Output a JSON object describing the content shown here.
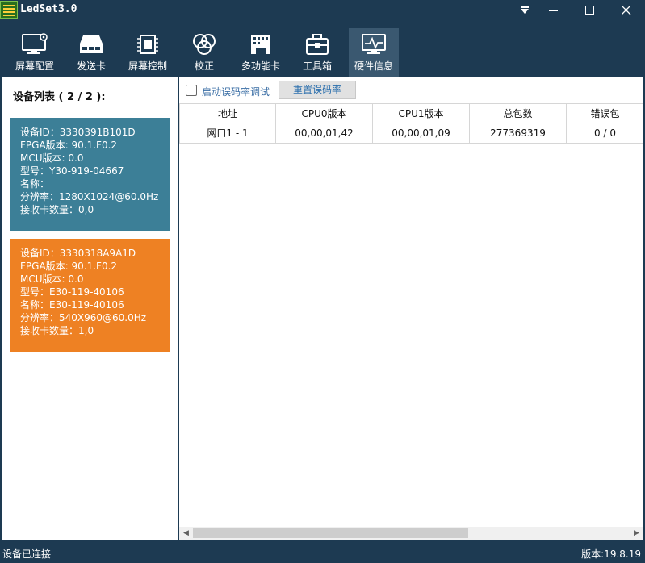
{
  "app": {
    "title": "LedSet3.0"
  },
  "toolbar": {
    "items": [
      {
        "label": "屏幕配置",
        "icon": "monitor-gear-icon"
      },
      {
        "label": "发送卡",
        "icon": "sender-card-icon"
      },
      {
        "label": "屏幕控制",
        "icon": "chip-icon"
      },
      {
        "label": "校正",
        "icon": "color-circles-icon"
      },
      {
        "label": "多功能卡",
        "icon": "multifunction-card-icon"
      },
      {
        "label": "工具箱",
        "icon": "toolbox-icon"
      },
      {
        "label": "硬件信息",
        "icon": "hardware-pulse-icon",
        "active": true
      }
    ]
  },
  "device_list": {
    "title": "设备列表 ( 2 / 2 ):",
    "devices": [
      {
        "color": "#3c7f97",
        "lines": [
          "设备ID：3330391B101D",
          "FPGA版本: 90.1.F0.2",
          "MCU版本: 0.0",
          "型号：Y30-919-04667",
          "名称：",
          "分辨率：1280X1024@60.0Hz",
          "接收卡数量：0,0"
        ]
      },
      {
        "color": "#ee8123",
        "lines": [
          "设备ID：3330318A9A1D",
          "FPGA版本: 90.1.F0.2",
          "MCU版本: 0.0",
          "型号：E30-119-40106",
          "名称：E30-119-40106",
          "分辨率：540X960@60.0Hz",
          "接收卡数量：1,0"
        ]
      }
    ]
  },
  "controls": {
    "debug_checkbox_label": "启动误码率调试",
    "debug_checked": false,
    "reset_button_label": "重置误码率"
  },
  "table": {
    "columns": [
      "地址",
      "CPU0版本",
      "CPU1版本",
      "总包数",
      "错误包"
    ],
    "rows": [
      [
        "网口1 - 1",
        "00,00,01,42",
        "00,00,01,09",
        "277369319",
        "0 / 0"
      ]
    ]
  },
  "status": {
    "left": "设备已连接",
    "right": "版本:19.8.19"
  },
  "colors": {
    "chrome": "#1d3a52",
    "active_tab": "#3a5870",
    "card_blue": "#3c7f97",
    "card_orange": "#ee8123",
    "link_blue": "#2b6fad"
  }
}
